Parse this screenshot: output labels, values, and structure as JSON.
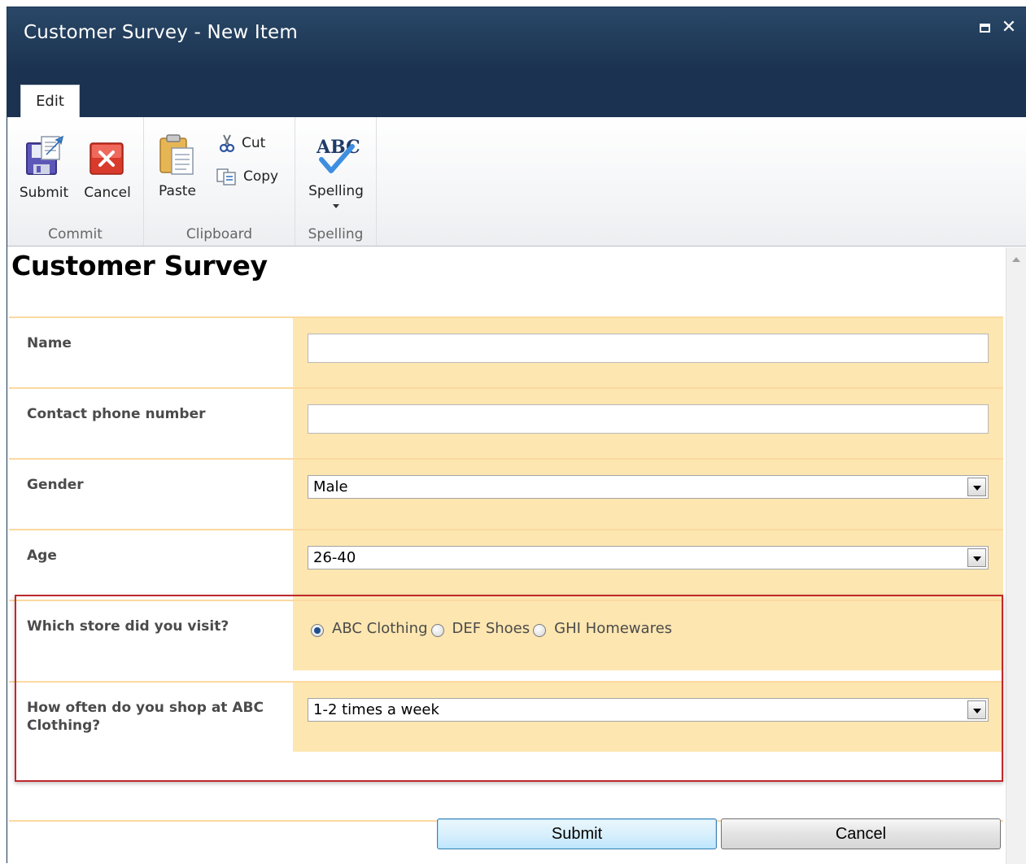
{
  "window": {
    "title": "Customer Survey - New Item"
  },
  "ribbon": {
    "tabs": [
      {
        "label": "Edit",
        "selected": true
      }
    ],
    "groups": [
      {
        "label": "Commit",
        "buttons": [
          {
            "label": "Submit",
            "icon": "save-icon"
          },
          {
            "label": "Cancel",
            "icon": "cancel-icon"
          }
        ]
      },
      {
        "label": "Clipboard",
        "buttons": [
          {
            "label": "Paste",
            "icon": "paste-icon"
          },
          {
            "label": "Cut",
            "icon": "cut-icon"
          },
          {
            "label": "Copy",
            "icon": "copy-icon"
          }
        ]
      },
      {
        "label": "Spelling",
        "buttons": [
          {
            "label": "Spelling",
            "icon": "spellcheck-icon"
          }
        ]
      }
    ]
  },
  "page": {
    "title": "Customer Survey"
  },
  "form": {
    "fields": [
      {
        "label": "Name",
        "type": "text",
        "value": ""
      },
      {
        "label": "Contact phone number",
        "type": "text",
        "value": ""
      },
      {
        "label": "Gender",
        "type": "select",
        "value": "Male"
      },
      {
        "label": "Age",
        "type": "select",
        "value": "26-40"
      },
      {
        "label": "Which store did you visit?",
        "type": "radio",
        "options": [
          "ABC Clothing",
          "DEF Shoes",
          "GHI Homewares"
        ],
        "selected": "ABC Clothing"
      },
      {
        "label": "How often do you shop at ABC Clothing?",
        "type": "select",
        "value": "1-2 times a week"
      }
    ],
    "submit_label": "Submit",
    "cancel_label": "Cancel"
  },
  "colors": {
    "titlebar": "#1b3350",
    "field_background": "#fde6b0",
    "row_separator": "#fbd9a0",
    "highlight": "#c0282c"
  }
}
